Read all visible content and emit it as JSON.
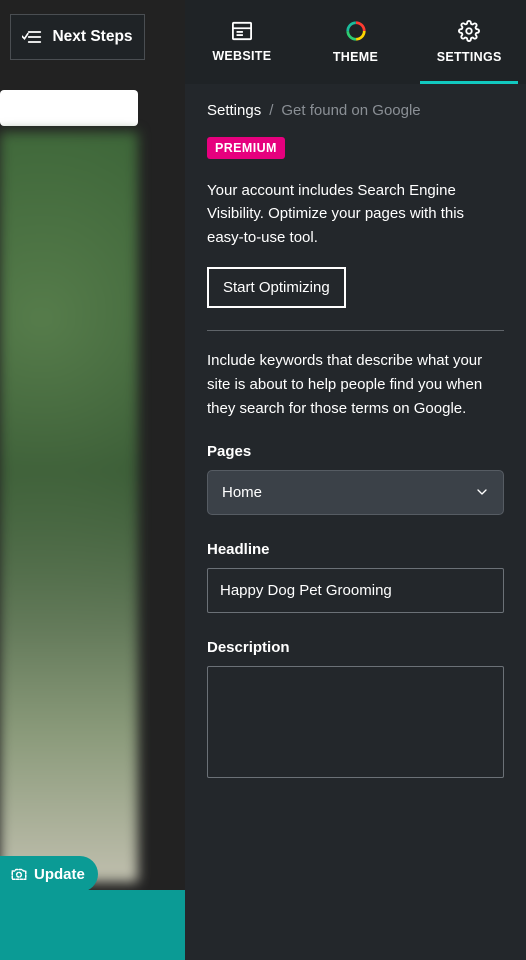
{
  "nextSteps": {
    "label": "Next Steps"
  },
  "update": {
    "label": "Update"
  },
  "tabs": {
    "website": "WEBSITE",
    "theme": "THEME",
    "settings": "SETTINGS",
    "active": "settings"
  },
  "breadcrumb": {
    "root": "Settings",
    "sep": "/",
    "current": "Get found on Google"
  },
  "premium": {
    "badge": "PREMIUM",
    "text": "Your account includes Search Engine Visibility. Optimize your pages with this easy-to-use tool.",
    "cta": "Start Optimizing"
  },
  "keywordsHelp": "Include keywords that describe what your site is about to help people find you when they search for those terms on Google.",
  "form": {
    "pagesLabel": "Pages",
    "pagesSelected": "Home",
    "headlineLabel": "Headline",
    "headlineValue": "Happy Dog Pet Grooming",
    "descriptionLabel": "Description",
    "descriptionValue": ""
  },
  "colors": {
    "accent": "#12c9c0",
    "premium": "#e6007e"
  }
}
